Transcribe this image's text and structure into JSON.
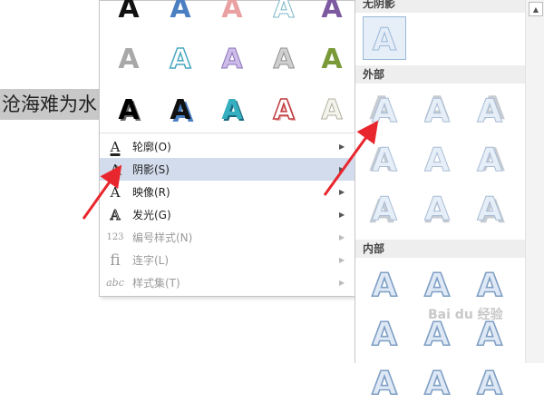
{
  "document": {
    "visible_text": "沧海难为水"
  },
  "menu": {
    "items": [
      {
        "label": "轮廓(O)",
        "icon": "outline-a-icon",
        "enabled": true,
        "highlighted": false
      },
      {
        "label": "阴影(S)",
        "icon": "shadow-a-icon",
        "enabled": true,
        "highlighted": true
      },
      {
        "label": "映像(R)",
        "icon": "reflection-a-icon",
        "enabled": true,
        "highlighted": false
      },
      {
        "label": "发光(G)",
        "icon": "glow-a-icon",
        "enabled": true,
        "highlighted": false
      },
      {
        "label": "编号样式(N)",
        "icon": "number-style-icon",
        "enabled": false,
        "highlighted": false
      },
      {
        "label": "连字(L)",
        "icon": "ligature-icon",
        "enabled": false,
        "highlighted": false
      },
      {
        "label": "样式集(T)",
        "icon": "style-set-icon",
        "enabled": false,
        "highlighted": false
      }
    ],
    "gallery_glyph": "A",
    "mini_glyphs": {
      "outline": "A",
      "shadow": "A",
      "reflection": "A",
      "glow": "A",
      "number": "123",
      "ligature": "fi",
      "style_set": "abc"
    }
  },
  "submenu": {
    "sections": [
      {
        "header": "无阴影",
        "count": 1
      },
      {
        "header": "外部",
        "count": 9
      },
      {
        "header": "内部",
        "count": 9
      }
    ],
    "glyph": "A"
  },
  "watermark": "Bai du 经验",
  "colors": {
    "highlight": "#d3dcec",
    "arrow": "#e8262d",
    "accent_blue": "#4a7fc1"
  }
}
